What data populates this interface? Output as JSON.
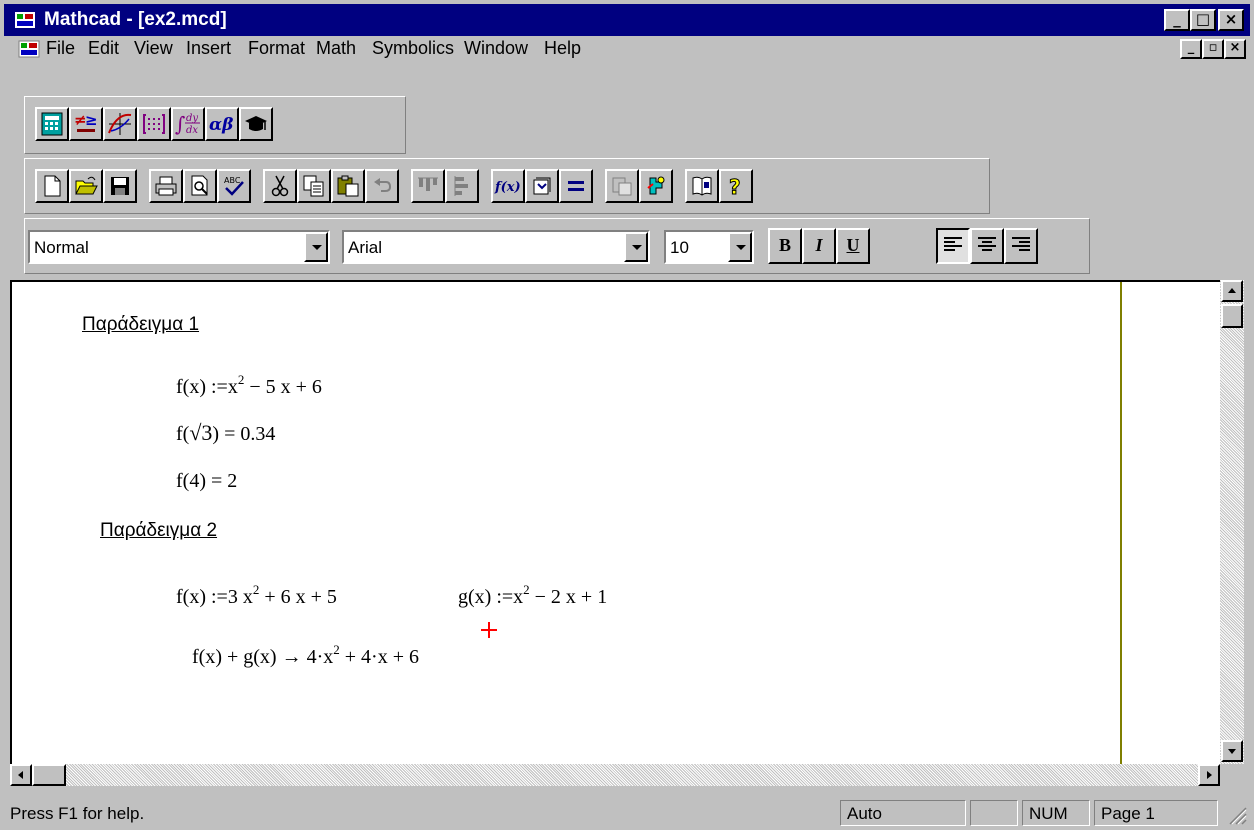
{
  "window": {
    "title": "Mathcad - [ex2.mcd]",
    "caption_buttons": [
      "_",
      "□",
      "×"
    ],
    "mdi_buttons": [
      "_",
      "▫",
      "×"
    ]
  },
  "menu": [
    "File",
    "Edit",
    "View",
    "Insert",
    "Format",
    "Math",
    "Symbolics",
    "Window",
    "Help"
  ],
  "palette_toolbar": [
    "calculator-palette-icon",
    "evaluation-palette-icon",
    "graph-palette-icon",
    "matrix-palette-icon",
    "calculus-palette-icon",
    "greek-palette-icon",
    "symbolic-palette-icon"
  ],
  "standard_toolbar": {
    "groups": [
      [
        "new-icon",
        "open-icon",
        "save-icon"
      ],
      [
        "print-icon",
        "print-preview-icon",
        "spell-check-icon"
      ],
      [
        "cut-icon",
        "copy-icon",
        "paste-icon",
        "undo-icon"
      ],
      [
        "align-across-icon",
        "align-down-icon"
      ],
      [
        "insert-function-icon",
        "insert-unit-icon",
        "calculate-icon"
      ],
      [
        "insert-hyperlink-icon",
        "component-wizard-icon"
      ],
      [
        "resource-center-icon",
        "help-icon"
      ]
    ],
    "insert_function_label": "f(x)"
  },
  "format_toolbar": {
    "style": "Normal",
    "font": "Arial",
    "size": "10",
    "bold": "B",
    "italic": "I",
    "underline": "U"
  },
  "document": {
    "heading1": "Παράδειγμα 1",
    "heading2": "Παράδειγμα 2",
    "ex1_def": {
      "pre": "f(x) :=x",
      "exp": "2",
      "post": " − 5 x + 6"
    },
    "ex1_eval1": {
      "pre": "f(",
      "arg": "√3",
      "post": ") = 0.34"
    },
    "ex1_eval2": "f(4) = 2",
    "ex2_f": {
      "pre": "f(x) :=3 x",
      "exp": "2",
      "post": " + 6 x + 5"
    },
    "ex2_g": {
      "pre": "g(x) :=x",
      "exp": "2",
      "post": " − 2 x + 1"
    },
    "ex2_sum": {
      "pre": "f(x) + g(x) → 4·x",
      "exp": "2",
      "post": " + 4·x + 6"
    }
  },
  "status": {
    "help": "Press F1 for help.",
    "mode": "Auto",
    "blank": "",
    "num": "NUM",
    "page": "Page 1"
  }
}
